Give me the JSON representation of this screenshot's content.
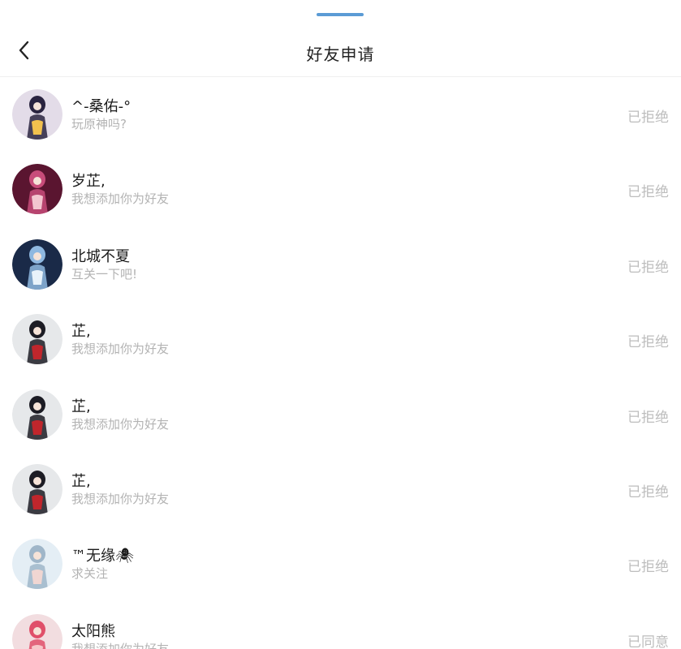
{
  "header": {
    "title": "好友申请",
    "back_icon": "chevron-left-icon"
  },
  "requests": [
    {
      "name": "^-桑佑-°",
      "message": "玩原神吗?",
      "status": "已拒绝",
      "avatar_colors": [
        "#e3dce8",
        "#2a2440",
        "#f2c14e"
      ]
    },
    {
      "name": "岁芷,",
      "message": "我想添加你为好友",
      "status": "已拒绝",
      "avatar_colors": [
        "#5a1530",
        "#c84c7a",
        "#f3c6d0"
      ]
    },
    {
      "name": "北城不夏",
      "message": "互关一下吧!",
      "status": "已拒绝",
      "avatar_colors": [
        "#1a2a48",
        "#8fb8e0",
        "#e8f2fa"
      ]
    },
    {
      "name": "芷,",
      "message": "我想添加你为好友",
      "status": "已拒绝",
      "avatar_colors": [
        "#e6e8ea",
        "#1c1c24",
        "#c0262c"
      ]
    },
    {
      "name": "芷,",
      "message": "我想添加你为好友",
      "status": "已拒绝",
      "avatar_colors": [
        "#e6e8ea",
        "#1c1c24",
        "#c0262c"
      ]
    },
    {
      "name": "芷,",
      "message": "我想添加你为好友",
      "status": "已拒绝",
      "avatar_colors": [
        "#e6e8ea",
        "#1c1c24",
        "#c0262c"
      ]
    },
    {
      "name": "™无缘🕷",
      "message": "求关注",
      "status": "已拒绝",
      "avatar_colors": [
        "#e4eef5",
        "#9fb6c9",
        "#f0d6d2"
      ]
    },
    {
      "name": "太阳熊",
      "message": "我想添加你为好友",
      "status": "已同意",
      "avatar_colors": [
        "#f2dde0",
        "#e0506a",
        "#f7c7c9"
      ]
    }
  ]
}
